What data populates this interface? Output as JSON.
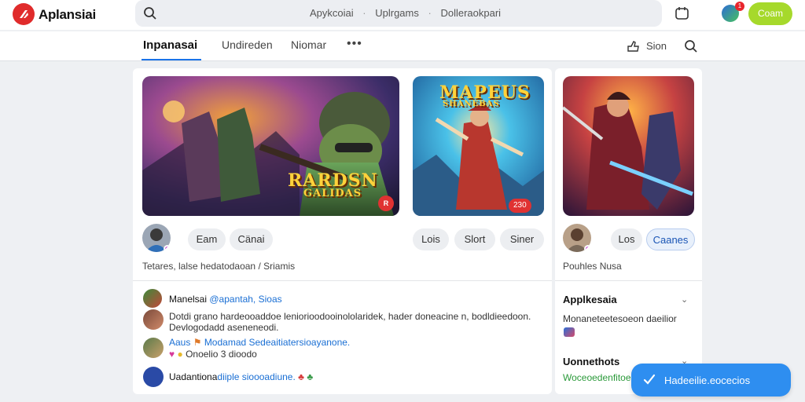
{
  "app": {
    "name": "Aplansiai"
  },
  "search": {
    "parts": [
      "Apykcoiai",
      "·",
      "Uplrgams",
      "·",
      "Dolleraokpari"
    ]
  },
  "header": {
    "action_label": "Coam",
    "notif_count": "1"
  },
  "tabs": [
    "Inpanasai",
    "Undireden",
    "Niomar"
  ],
  "tab_more": "•••",
  "tab_actions": {
    "share_label": "Sion"
  },
  "banners": [
    {
      "title_line1": "RARDSN",
      "title_line2": "GALIDAS",
      "badge": "R"
    },
    {
      "title_line1": "MAPEUS",
      "title_line2": "SHANEBAS",
      "badge": "230"
    },
    {
      "title_line1": "",
      "title_line2": "",
      "badge": ""
    }
  ],
  "pills_main": [
    "Eam",
    "Cänai"
  ],
  "pills_mid": [
    "Lois",
    "Slort",
    "Siner"
  ],
  "pills_side": [
    "Los",
    "Caanes"
  ],
  "stats_main": "Tetares, lalse hedatodaoan / Sriamis",
  "stats_side": "Pouhles Nusa",
  "feed": [
    {
      "name": "Manelsai",
      "handle": "@apantah, Sioas"
    },
    {
      "line1": "Dotdi grano hardeooaddoe leniorioodooinololaridek, hader doneacine n, bodldieedoon.",
      "line2": "Devlogodadd aseneneodi."
    },
    {
      "prefix": "Aaus",
      "highlight": "Modamad Sedeaitiatersioayanone.",
      "line2": "Onoelio 3 dioodo"
    },
    {
      "name": "Uadantiona",
      "highlight": "diiple sioooadiune."
    }
  ],
  "side_sections": [
    {
      "title": "Applkesaia",
      "text": "Monaneteetesoeon daeilior"
    },
    {
      "title": "Uonnethots",
      "text": "Woceoedenfitoenndfkaior"
    }
  ],
  "float_button": {
    "label": "Hadeeilie.eocecios"
  }
}
